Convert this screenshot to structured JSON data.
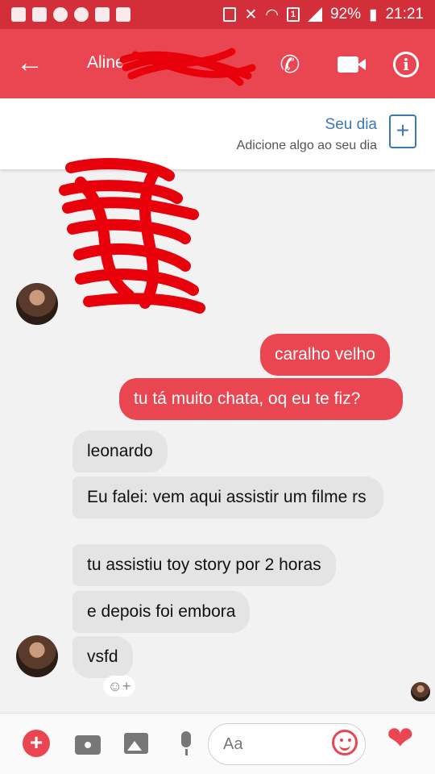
{
  "status_bar": {
    "battery": "92%",
    "time": "21:21"
  },
  "header": {
    "contact_name": "Aline",
    "back_icon": "arrow-left-icon",
    "call_icon": "phone-icon",
    "video_icon": "video-camera-icon",
    "info_icon": "info-icon"
  },
  "story": {
    "title": "Seu dia",
    "subtitle": "Adicione algo ao seu dia",
    "add_label": "+"
  },
  "messages": [
    {
      "from": "me",
      "text": "caralho velho"
    },
    {
      "from": "me",
      "text": "tu tá muito chata, oq eu te fiz?"
    },
    {
      "from": "them",
      "text": "leonardo"
    },
    {
      "from": "them",
      "text": "Eu falei: vem aqui assistir um filme rs"
    },
    {
      "from": "them",
      "text": "tu assistiu toy story por 2 horas"
    },
    {
      "from": "them",
      "text": "e depois foi embora"
    },
    {
      "from": "them",
      "text": "vsfd"
    }
  ],
  "reaction_glyph": "☺+",
  "composer": {
    "placeholder": "Aa",
    "plus_label": "+",
    "like_glyph": "❤"
  },
  "colors": {
    "accent": "#ea4651",
    "status_bar": "#d32f3a",
    "link": "#3b76b5",
    "bubble_them": "#e4e4e4"
  }
}
